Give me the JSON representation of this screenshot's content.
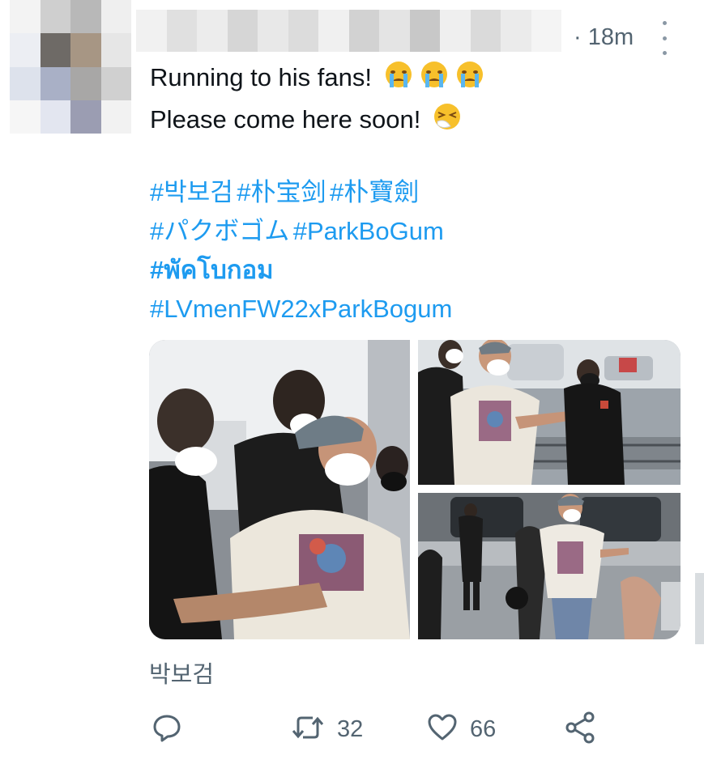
{
  "tweet": {
    "timestamp": "· 18m",
    "lines": [
      "Running to his fans!",
      "Please come here soon!"
    ],
    "hashtags": {
      "line1": [
        "#박보검",
        "#朴宝剑",
        "#朴寶劍"
      ],
      "line2": [
        "#パクボゴム",
        "#ParkBoGum"
      ],
      "line3": "#พัคโบกอม",
      "line4": "#LVmenFW22xParkBogum"
    },
    "location": "박보검",
    "actions": {
      "reply_icon": "reply-icon",
      "retweet_icon": "retweet-icon",
      "retweet_count": "32",
      "like_icon": "like-icon",
      "like_count": "66",
      "share_icon": "share-icon"
    }
  },
  "colors": {
    "link": "#1d9bf0",
    "secondary_text": "#536471",
    "primary_text": "#0f1419"
  },
  "media": {
    "count": 3,
    "descriptions_icons": [
      "photo-left",
      "photo-top-right",
      "photo-bottom-right"
    ]
  }
}
